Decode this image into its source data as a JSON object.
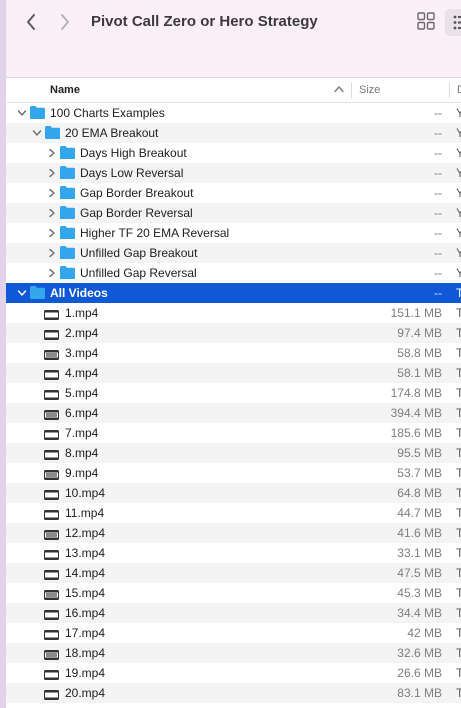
{
  "window": {
    "title": "Pivot Call Zero or Hero Strategy"
  },
  "toolbar": {
    "back_icon": "chevron-left-icon",
    "forward_icon": "chevron-right-icon",
    "view_icon": "grid-view-icon",
    "more_icon": "more-options-icon"
  },
  "columns": {
    "name": "Name",
    "size": "Size",
    "date": "D"
  },
  "colors": {
    "selection": "#0f58d6",
    "folder": "#34a6ee",
    "titlebar": "#fbf0f8"
  },
  "rows": [
    {
      "kind": "folder",
      "depth": 0,
      "expanded": true,
      "name": "100 Charts Examples",
      "size": "--",
      "date": "Y"
    },
    {
      "kind": "folder",
      "depth": 1,
      "expanded": true,
      "name": "20 EMA Breakout",
      "size": "--",
      "date": "Y"
    },
    {
      "kind": "folder",
      "depth": 2,
      "expanded": false,
      "name": "Days High Breakout",
      "size": "--",
      "date": "Y"
    },
    {
      "kind": "folder",
      "depth": 2,
      "expanded": false,
      "name": "Days Low Reversal",
      "size": "--",
      "date": "Y"
    },
    {
      "kind": "folder",
      "depth": 2,
      "expanded": false,
      "name": "Gap Border Breakout",
      "size": "--",
      "date": "Y"
    },
    {
      "kind": "folder",
      "depth": 2,
      "expanded": false,
      "name": "Gap Border Reversal",
      "size": "--",
      "date": "Y"
    },
    {
      "kind": "folder",
      "depth": 2,
      "expanded": false,
      "name": "Higher TF 20 EMA Reversal",
      "size": "--",
      "date": "Y"
    },
    {
      "kind": "folder",
      "depth": 2,
      "expanded": false,
      "name": "Unfilled Gap Breakout",
      "size": "--",
      "date": "Y"
    },
    {
      "kind": "folder",
      "depth": 2,
      "expanded": false,
      "name": "Unfilled Gap Reversal",
      "size": "--",
      "date": "Y"
    },
    {
      "kind": "folder",
      "depth": 0,
      "expanded": true,
      "selected": true,
      "name": "All Videos",
      "size": "--",
      "date": "T"
    },
    {
      "kind": "video",
      "depth": 1,
      "name": "1.mp4",
      "size": "151.1 MB",
      "date": "T"
    },
    {
      "kind": "video",
      "depth": 1,
      "name": "2.mp4",
      "size": "97.4 MB",
      "date": "T"
    },
    {
      "kind": "video",
      "depth": 1,
      "name": "3.mp4",
      "size": "58.8 MB",
      "date": "T"
    },
    {
      "kind": "video",
      "depth": 1,
      "name": "4.mp4",
      "size": "58.1 MB",
      "date": "T"
    },
    {
      "kind": "video",
      "depth": 1,
      "name": "5.mp4",
      "size": "174.8 MB",
      "date": "T"
    },
    {
      "kind": "video",
      "depth": 1,
      "name": "6.mp4",
      "size": "394.4 MB",
      "date": "T"
    },
    {
      "kind": "video",
      "depth": 1,
      "name": "7.mp4",
      "size": "185.6 MB",
      "date": "T"
    },
    {
      "kind": "video",
      "depth": 1,
      "name": "8.mp4",
      "size": "95.5 MB",
      "date": "T"
    },
    {
      "kind": "video",
      "depth": 1,
      "name": "9.mp4",
      "size": "53.7 MB",
      "date": "T"
    },
    {
      "kind": "video",
      "depth": 1,
      "name": "10.mp4",
      "size": "64.8 MB",
      "date": "T"
    },
    {
      "kind": "video",
      "depth": 1,
      "name": "11.mp4",
      "size": "44.7 MB",
      "date": "T"
    },
    {
      "kind": "video",
      "depth": 1,
      "name": "12.mp4",
      "size": "41.6 MB",
      "date": "T"
    },
    {
      "kind": "video",
      "depth": 1,
      "name": "13.mp4",
      "size": "33.1 MB",
      "date": "T"
    },
    {
      "kind": "video",
      "depth": 1,
      "name": "14.mp4",
      "size": "47.5 MB",
      "date": "T"
    },
    {
      "kind": "video",
      "depth": 1,
      "name": "15.mp4",
      "size": "45.3 MB",
      "date": "T"
    },
    {
      "kind": "video",
      "depth": 1,
      "name": "16.mp4",
      "size": "34.4 MB",
      "date": "T"
    },
    {
      "kind": "video",
      "depth": 1,
      "name": "17.mp4",
      "size": "42 MB",
      "date": "T"
    },
    {
      "kind": "video",
      "depth": 1,
      "name": "18.mp4",
      "size": "32.6 MB",
      "date": "T"
    },
    {
      "kind": "video",
      "depth": 1,
      "name": "19.mp4",
      "size": "26.6 MB",
      "date": "T"
    },
    {
      "kind": "video",
      "depth": 1,
      "name": "20.mp4",
      "size": "83.1 MB",
      "date": "T"
    }
  ]
}
